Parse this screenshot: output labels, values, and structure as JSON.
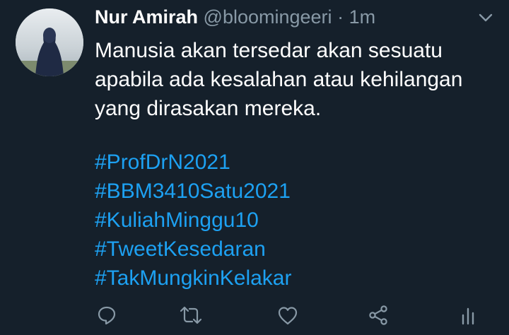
{
  "tweet": {
    "author_name": "Nur Amirah",
    "handle": "@bloomingeeri",
    "separator": "·",
    "time": "1m",
    "body_lines": [
      "Manusia akan tersedar akan sesuatu",
      "apabila ada kesalahan atau kehilangan",
      "yang dirasakan mereka."
    ],
    "hashtags": [
      "#ProfDrN2021",
      "#BBM3410Satu2021",
      "#KuliahMinggu10",
      "#TweetKesedaran",
      "#TakMungkinKelakar"
    ]
  },
  "icons": {
    "more": "chevron-down-icon",
    "reply": "reply-icon",
    "retweet": "retweet-icon",
    "like": "heart-icon",
    "share": "share-icon",
    "analytics": "analytics-icon"
  },
  "colors": {
    "background": "#15202b",
    "text": "#ffffff",
    "secondary_text": "#8899a6",
    "link": "#1da1f2"
  }
}
